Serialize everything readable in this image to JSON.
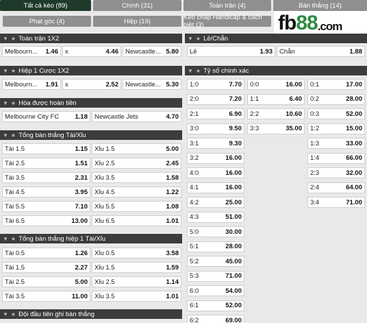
{
  "tabs": [
    {
      "label": "Tất cả kèo (89)",
      "active": true
    },
    {
      "label": "Chính (31)"
    },
    {
      "label": "Toàn trận (4)"
    },
    {
      "label": "Bàn thắng (14)"
    },
    {
      "label": "Phạt góc (4)"
    },
    {
      "label": "Hiệp (19)"
    },
    {
      "label": "Kèo chấp Handicap & cách biệt (3)"
    }
  ],
  "logo": {
    "fb": "fb",
    "n88": "88",
    "com": ".com"
  },
  "icons": {
    "collapse": "chevron-down-icon",
    "favorite": "star-icon"
  },
  "left": {
    "full_time": {
      "title": "Toàn trận 1X2",
      "outcomes": [
        {
          "label": "Melbourn...",
          "odd": "1.46"
        },
        {
          "label": "x",
          "odd": "4.46"
        },
        {
          "label": "Newcastle...",
          "odd": "5.80"
        }
      ]
    },
    "first_half": {
      "title": "Hiệp 1 Cược 1X2",
      "outcomes": [
        {
          "label": "Melbourn...",
          "odd": "1.91"
        },
        {
          "label": "x",
          "odd": "2.52"
        },
        {
          "label": "Newcastle...",
          "odd": "5.30"
        }
      ]
    },
    "draw_no_bet": {
      "title": "Hòa được hoàn tiền",
      "outcomes": [
        {
          "label": "Melbourne City FC",
          "odd": "1.18"
        },
        {
          "label": "Newcastle Jets",
          "odd": "4.70"
        }
      ]
    },
    "total_goals": {
      "title": "Tổng bàn thắng Tài/Xỉu",
      "rows": [
        [
          {
            "label": "Tài 1.5",
            "odd": "1.15"
          },
          {
            "label": "Xỉu 1.5",
            "odd": "5.00"
          }
        ],
        [
          {
            "label": "Tài 2.5",
            "odd": "1.51"
          },
          {
            "label": "Xỉu 2.5",
            "odd": "2.45"
          }
        ],
        [
          {
            "label": "Tài 3.5",
            "odd": "2.31"
          },
          {
            "label": "Xỉu 3.5",
            "odd": "1.58"
          }
        ],
        [
          {
            "label": "Tài 4.5",
            "odd": "3.95"
          },
          {
            "label": "Xỉu 4.5",
            "odd": "1.22"
          }
        ],
        [
          {
            "label": "Tài 5.5",
            "odd": "7.10"
          },
          {
            "label": "Xỉu 5.5",
            "odd": "1.08"
          }
        ],
        [
          {
            "label": "Tài 6.5",
            "odd": "13.00"
          },
          {
            "label": "Xỉu 6.5",
            "odd": "1.01"
          }
        ]
      ]
    },
    "total_goals_h1": {
      "title": "Tổng bàn thắng hiệp 1 Tài/Xỉu",
      "rows": [
        [
          {
            "label": "Tài 0.5",
            "odd": "1.26"
          },
          {
            "label": "Xỉu 0.5",
            "odd": "3.58"
          }
        ],
        [
          {
            "label": "Tài 1.5",
            "odd": "2.27"
          },
          {
            "label": "Xỉu 1.5",
            "odd": "1.59"
          }
        ],
        [
          {
            "label": "Tài 2.5",
            "odd": "5.00"
          },
          {
            "label": "Xỉu 2.5",
            "odd": "1.14"
          }
        ],
        [
          {
            "label": "Tài 3.5",
            "odd": "11.00"
          },
          {
            "label": "Xỉu 3.5",
            "odd": "1.01"
          }
        ]
      ]
    },
    "first_scorer": {
      "title": "Đội đầu tiên ghi bàn thắng"
    }
  },
  "right": {
    "odd_even": {
      "title": "Lẻ/Chẵn",
      "outcomes": [
        {
          "label": "Lẻ",
          "odd": "1.93"
        },
        {
          "label": "Chẵn",
          "odd": "1.88"
        }
      ]
    },
    "correct_score": {
      "title": "Tỷ số chính xác",
      "col1": [
        {
          "label": "1:0",
          "odd": "7.70"
        },
        {
          "label": "2:0",
          "odd": "7.20"
        },
        {
          "label": "2:1",
          "odd": "6.90"
        },
        {
          "label": "3:0",
          "odd": "9.50"
        },
        {
          "label": "3:1",
          "odd": "9.30"
        },
        {
          "label": "3:2",
          "odd": "16.00"
        },
        {
          "label": "4:0",
          "odd": "16.00"
        },
        {
          "label": "4:1",
          "odd": "16.00"
        },
        {
          "label": "4:2",
          "odd": "25.00"
        },
        {
          "label": "4:3",
          "odd": "51.00"
        },
        {
          "label": "5:0",
          "odd": "30.00"
        },
        {
          "label": "5:1",
          "odd": "28.00"
        },
        {
          "label": "5:2",
          "odd": "45.00"
        },
        {
          "label": "5:3",
          "odd": "71.00"
        },
        {
          "label": "6:0",
          "odd": "54.00"
        },
        {
          "label": "6:1",
          "odd": "52.00"
        },
        {
          "label": "6:2",
          "odd": "69.00"
        }
      ],
      "col2": [
        {
          "label": "0:0",
          "odd": "16.00"
        },
        {
          "label": "1:1",
          "odd": "6.40"
        },
        {
          "label": "2:2",
          "odd": "10.60"
        },
        {
          "label": "3:3",
          "odd": "35.00"
        }
      ],
      "col3": [
        {
          "label": "0:1",
          "odd": "17.00"
        },
        {
          "label": "0:2",
          "odd": "28.00"
        },
        {
          "label": "0:3",
          "odd": "52.00"
        },
        {
          "label": "1:2",
          "odd": "15.00"
        },
        {
          "label": "1:3",
          "odd": "33.00"
        },
        {
          "label": "1:4",
          "odd": "66.00"
        },
        {
          "label": "2:3",
          "odd": "32.00"
        },
        {
          "label": "2:4",
          "odd": "64.00"
        },
        {
          "label": "3:4",
          "odd": "71.00"
        }
      ]
    }
  }
}
